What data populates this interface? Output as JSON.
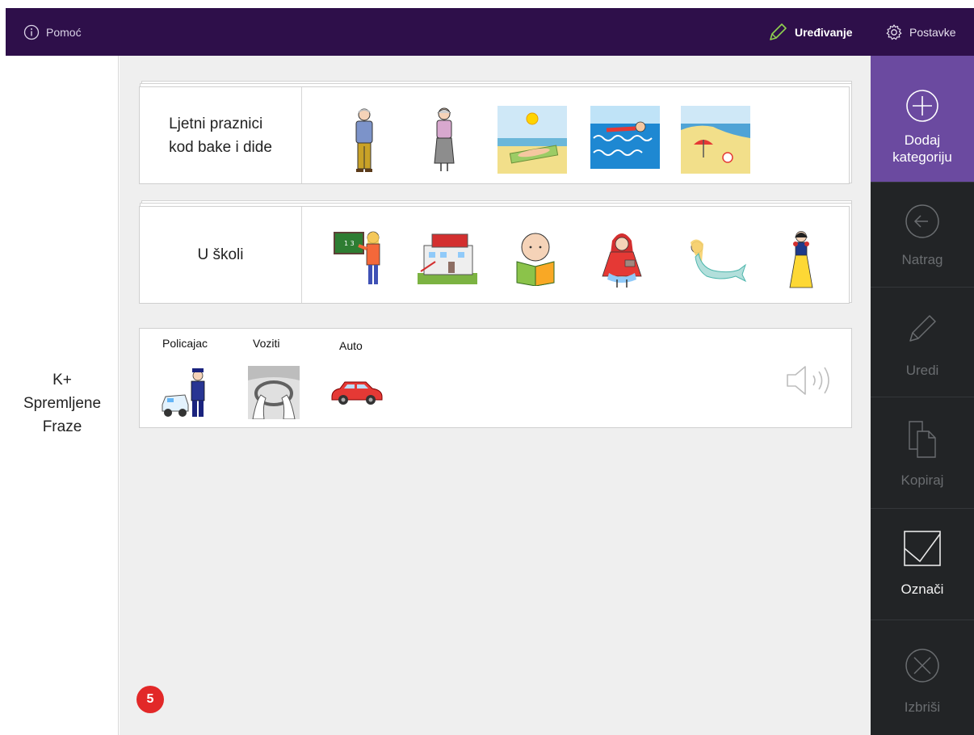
{
  "topbar": {
    "help_label": "Pomoć",
    "edit_label": "Uređivanje",
    "settings_label": "Postavke"
  },
  "left_panel": {
    "title_line1": "K+",
    "title_line2": "Spremljene",
    "title_line3": "Fraze"
  },
  "categories": [
    {
      "label_line1": "Ljetni praznici",
      "label_line2": "kod bake i dide",
      "pictures": [
        "grandfather",
        "grandmother",
        "sunbathing",
        "swimming",
        "beach"
      ]
    },
    {
      "label_line1": "U školi",
      "label_line2": "",
      "pictures": [
        "teacher-blackboard",
        "school-building",
        "child-reading",
        "red-riding-hood",
        "mermaid",
        "snow-white"
      ]
    }
  ],
  "phrase": {
    "words": [
      "Policajac",
      "Voziti",
      "Auto"
    ],
    "speaker_icon": "speaker-icon"
  },
  "badge_count": "5",
  "right_panel": {
    "add_label_line1": "Dodaj",
    "add_label_line2": "kategoriju",
    "back_label": "Natrag",
    "edit_label": "Uredi",
    "copy_label": "Kopiraj",
    "select_label": "Označi",
    "delete_label": "Izbriši"
  },
  "colors": {
    "topbar": "#2e0f4a",
    "accent": "#6b4aa0",
    "side_dark": "#222426",
    "badge": "#e22828"
  }
}
